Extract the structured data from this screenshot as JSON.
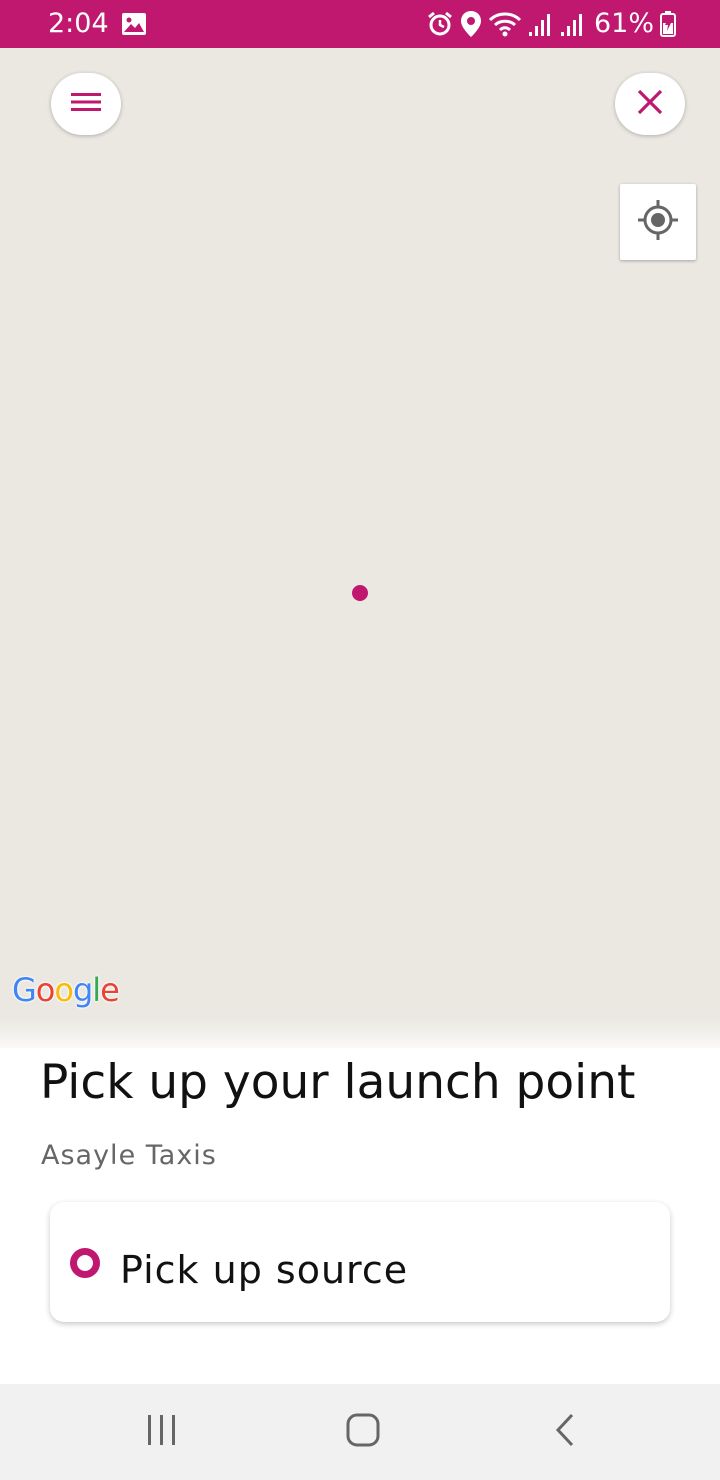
{
  "status_bar": {
    "time": "2:04",
    "battery": "61%",
    "color": "#c0186f",
    "icons": [
      "gallery-icon",
      "alarm-icon",
      "location-icon",
      "wifi-icon",
      "signal-icon",
      "signal-icon",
      "battery-charging-icon"
    ]
  },
  "map": {
    "menu_icon": "hamburger-menu-icon",
    "close_icon": "close-icon",
    "locate_icon": "my-location-icon",
    "google_logo": {
      "letters": [
        "G",
        "o",
        "o",
        "g",
        "l",
        "e"
      ],
      "colors": [
        "#4285F4",
        "#EA4335",
        "#FBBC05",
        "#4285F4",
        "#34A853",
        "#EA4335"
      ]
    }
  },
  "sheet": {
    "title": "Pick up your launch point",
    "subtitle": "Asayle Taxis",
    "pickup_label": "Pick up source",
    "accent_color": "#c0186f"
  },
  "nav_bar": {
    "icons": [
      "recents-icon",
      "home-icon",
      "back-icon"
    ]
  }
}
